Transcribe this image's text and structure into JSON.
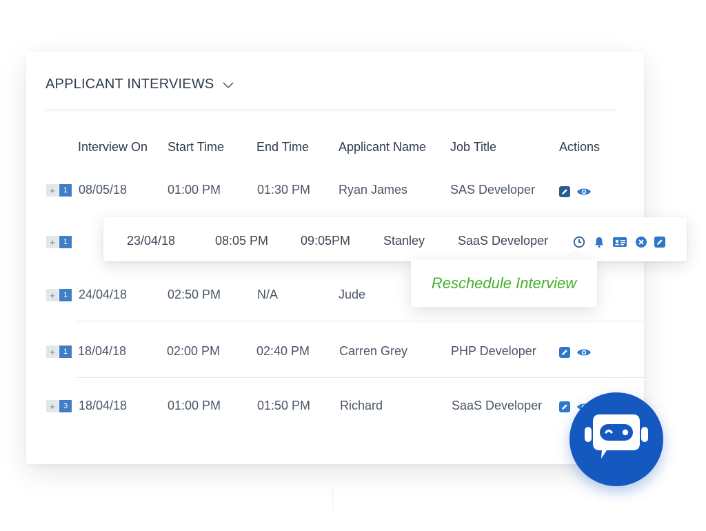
{
  "header": {
    "title": "APPLICANT INTERVIEWS"
  },
  "columns": [
    "Interview On",
    "Start Time",
    "End Time",
    "Applicant Name",
    "Job Title",
    "Actions"
  ],
  "rows": [
    {
      "count": "1",
      "date": "08/05/18",
      "start": "01:00 PM",
      "end": "01:30 PM",
      "name": "Ryan James",
      "job": "SAS Developer"
    },
    {
      "count": "1",
      "date": "",
      "start": "",
      "end": "",
      "name": "",
      "job": ""
    },
    {
      "count": "1",
      "date": "24/04/18",
      "start": "02:50 PM",
      "end": "N/A",
      "name": "Jude",
      "job": ""
    },
    {
      "count": "1",
      "date": "18/04/18",
      "start": "02:00 PM",
      "end": "02:40 PM",
      "name": "Carren Grey",
      "job": "PHP Developer"
    },
    {
      "count": "3",
      "date": "18/04/18",
      "start": "01:00 PM",
      "end": "01:50 PM",
      "name": "Richard",
      "job": "SaaS Developer"
    }
  ],
  "floating_row": {
    "date": "23/04/18",
    "start": "08:05 PM",
    "end": "09:05PM",
    "name": "Stanley",
    "job": "SaaS Developer"
  },
  "tooltip": {
    "text": "Reschedule Interview"
  },
  "expander_plus": "+",
  "icons": {
    "edit": "edit-icon",
    "view": "eye-icon",
    "reschedule": "clock-icon",
    "remind": "bell-icon",
    "profile": "id-card-icon",
    "cancel": "close-circle-icon",
    "chatbot": "chatbot-icon"
  },
  "colors": {
    "accent": "#2d78c8",
    "dark_icon": "#2a5d8f",
    "tooltip": "#43b02a",
    "chatbot": "#1559c0"
  }
}
